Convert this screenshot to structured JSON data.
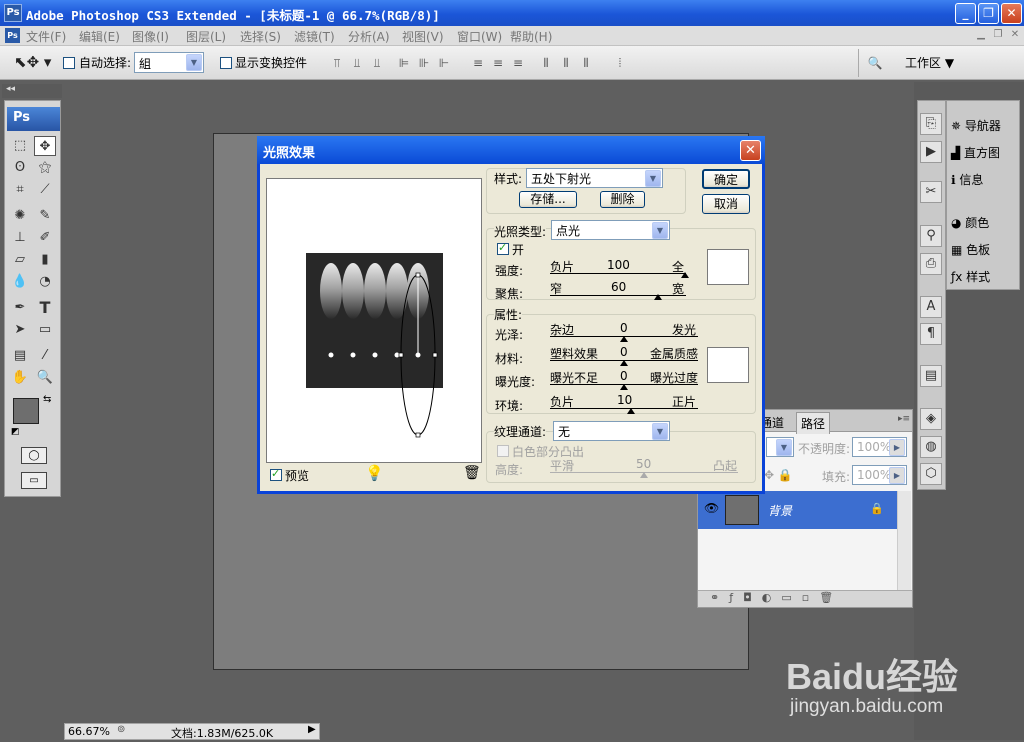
{
  "window": {
    "title": "Adobe Photoshop CS3 Extended - [未标题-1 @ 66.7%(RGB/8)]",
    "logo": "Ps",
    "min": "_",
    "max": "❐",
    "close": "✕"
  },
  "menu": {
    "items": [
      "文件(F)",
      "编辑(E)",
      "图像(I)",
      "图层(L)",
      "选择(S)",
      "滤镜(T)",
      "分析(A)",
      "视图(V)",
      "窗口(W)",
      "帮助(H)"
    ]
  },
  "options": {
    "auto_select_label": "自动选择:",
    "auto_select_value": "組",
    "show_transform_label": "显示变换控件",
    "workspace_label": "工作区 ▼"
  },
  "toolbox": {
    "logo": "Ps"
  },
  "right_panels": {
    "items": [
      "导航器",
      "直方图",
      "信息",
      "颜色",
      "色板",
      "样式"
    ]
  },
  "layers": {
    "tabs": [
      "通道",
      "路径"
    ],
    "opacity_label": "不透明度:",
    "opacity_value": "100%",
    "fill_label": "填充:",
    "fill_value": "100%",
    "layer_name": "背景"
  },
  "status": {
    "zoom": "66.67%",
    "doc_info": "文档:1.83M/625.0K"
  },
  "dialog": {
    "title": "光照效果",
    "preview_label": "预览",
    "style_label": "样式:",
    "style_value": "五处下射光",
    "save_btn": "存储...",
    "delete_btn": "删除",
    "ok_btn": "确定",
    "cancel_btn": "取消",
    "light_type_label": "光照类型:",
    "light_type_value": "点光",
    "on_label": "开",
    "intensity": {
      "label": "强度:",
      "min": "负片",
      "value": "100",
      "max": "全"
    },
    "focus": {
      "label": "聚焦:",
      "min": "窄",
      "value": "60",
      "max": "宽"
    },
    "properties_label": "属性:",
    "gloss": {
      "label": "光泽:",
      "min": "杂边",
      "value": "0",
      "max": "发光"
    },
    "material": {
      "label": "材料:",
      "min": "塑料效果",
      "value": "0",
      "max": "金属质感"
    },
    "exposure": {
      "label": "曝光度:",
      "min": "曝光不足",
      "value": "0",
      "max": "曝光过度"
    },
    "ambience": {
      "label": "环境:",
      "min": "负片",
      "value": "10",
      "max": "正片"
    },
    "texture_label": "纹理通道:",
    "texture_value": "无",
    "white_high_label": "白色部分凸出",
    "height": {
      "label": "高度:",
      "min": "平滑",
      "value": "50",
      "max": "凸起"
    }
  },
  "watermark": {
    "brand": "Baidu经验",
    "url": "jingyan.baidu.com"
  }
}
